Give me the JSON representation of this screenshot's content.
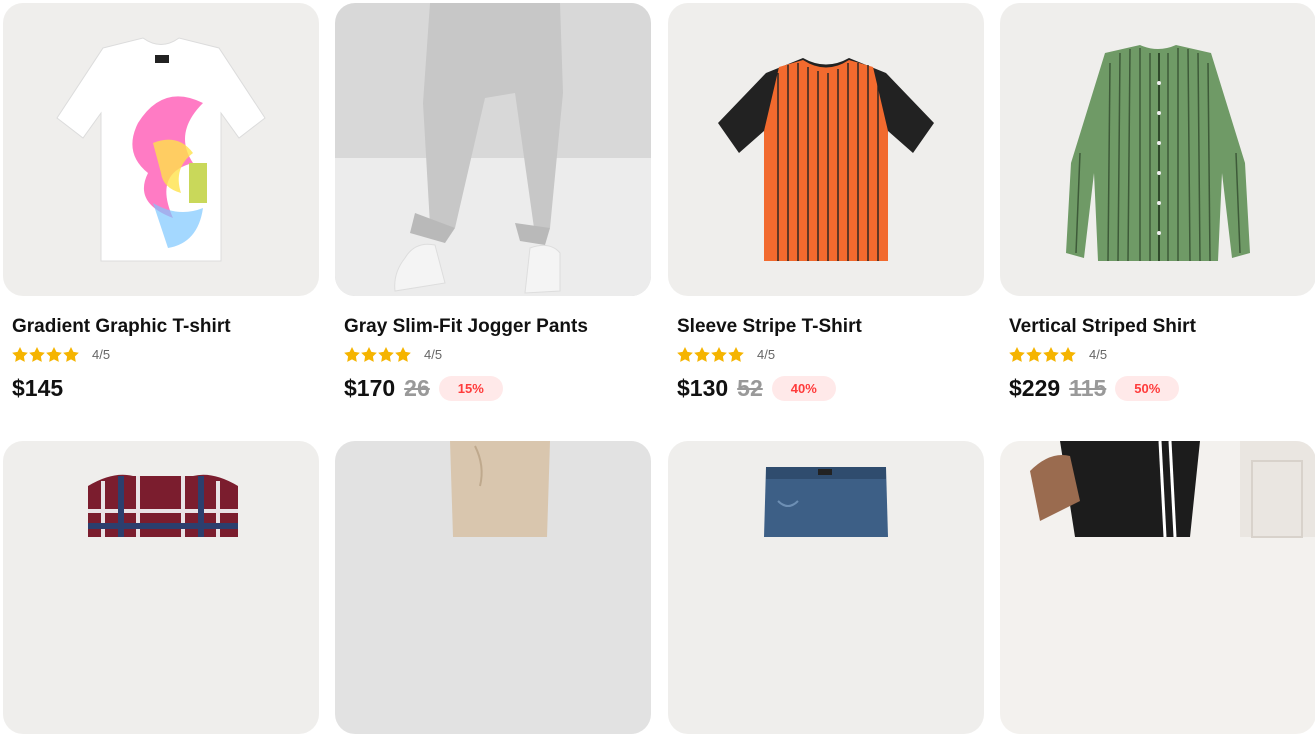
{
  "products": [
    {
      "title": "Gradient Graphic T-shirt",
      "rating_text": "4/5",
      "price": "$145",
      "old_price": "",
      "discount": "",
      "image": "white-tshirt-image"
    },
    {
      "title": "Gray Slim-Fit Jogger Pants",
      "rating_text": "4/5",
      "price": "$170",
      "old_price": "26",
      "discount": "15%",
      "image": "gray-joggers-image"
    },
    {
      "title": "Sleeve Stripe T-Shirt",
      "rating_text": "4/5",
      "price": "$130",
      "old_price": "52",
      "discount": "40%",
      "image": "orange-tshirt-image"
    },
    {
      "title": "Vertical Striped Shirt",
      "rating_text": "4/5",
      "price": "$229",
      "old_price": "115",
      "discount": "50%",
      "image": "green-shirt-image"
    }
  ],
  "row2": [
    {
      "image": "plaid-shirt-image"
    },
    {
      "image": "beige-pants-image"
    },
    {
      "image": "denim-shorts-image"
    },
    {
      "image": "black-track-pants-image"
    }
  ],
  "colors": {
    "star": "#f5b400",
    "badge_bg": "#ffe9e9",
    "badge_text": "#ff3b3b",
    "card_bg": "#efeeec"
  }
}
